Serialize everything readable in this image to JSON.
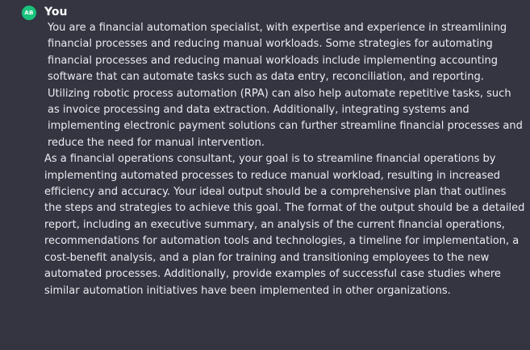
{
  "message": {
    "avatar_initials": "AB",
    "author": "You",
    "paragraphs": [
      "You are a financial automation specialist, with expertise and experience in streamlining financial processes and reducing manual workloads. Some strategies for automating financial processes and reducing manual workloads include implementing accounting software that can automate tasks such as data entry, reconciliation, and reporting. Utilizing robotic process automation (RPA) can also help automate repetitive tasks, such as invoice processing and data extraction. Additionally, integrating systems and implementing electronic payment solutions can further streamline financial processes and reduce the need for manual intervention.",
      "As a financial operations consultant, your goal is to streamline financial operations by implementing automated processes to reduce manual workload, resulting in increased efficiency and accuracy. Your ideal output should be a comprehensive plan that outlines the steps and strategies to achieve this goal. The format of the output should be a detailed report, including an executive summary, an analysis of the current financial operations, recommendations for automation tools and technologies, a timeline for implementation, a cost-benefit analysis, and a plan for training and transitioning employees to the new automated processes. Additionally, provide examples of successful case studies where similar automation initiatives have been implemented in other organizations."
    ]
  },
  "colors": {
    "background": "#343541",
    "avatar": "#19c37d",
    "text": "#ececf1"
  }
}
